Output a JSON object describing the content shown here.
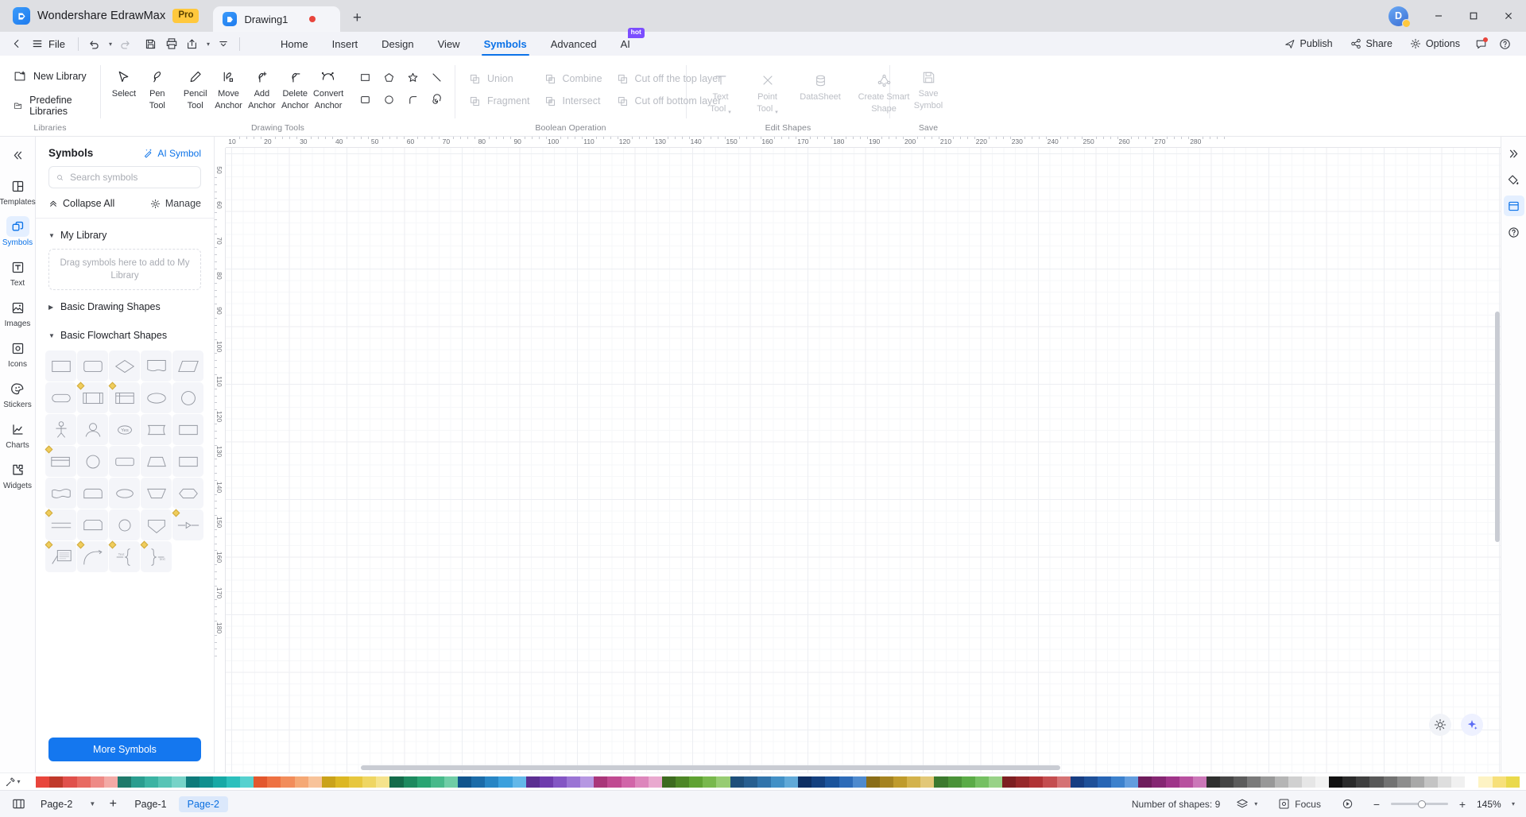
{
  "titlebar": {
    "app_name": "Wondershare EdrawMax",
    "pro_badge": "Pro",
    "document_tab": "Drawing1",
    "new_tab_label": "+",
    "avatar_initial": "D",
    "minimize": "─",
    "maximize": "□",
    "close": "✕"
  },
  "menubar": {
    "back_icon": "back-chevron-icon",
    "file_label": "File",
    "undo_icon": "undo-icon",
    "redo_icon": "redo-icon",
    "save_icon": "save-icon",
    "print_icon": "print-icon",
    "export_icon": "export-icon",
    "more_icon": "more-chevron-icon",
    "tabs": [
      {
        "label": "Home",
        "active": false
      },
      {
        "label": "Insert",
        "active": false
      },
      {
        "label": "Design",
        "active": false
      },
      {
        "label": "View",
        "active": false
      },
      {
        "label": "Symbols",
        "active": true
      },
      {
        "label": "Advanced",
        "active": false
      },
      {
        "label": "AI",
        "active": false,
        "badge": "hot"
      }
    ],
    "right_items": [
      {
        "label": "Publish",
        "icon": "publish-icon"
      },
      {
        "label": "Share",
        "icon": "share-icon"
      },
      {
        "label": "Options",
        "icon": "options-gear-icon"
      }
    ],
    "help_icon": "help-circle-icon",
    "chat_icon": "chat-bubble-icon"
  },
  "ribbon": {
    "groups": [
      {
        "title": "Libraries",
        "items": [
          {
            "label": "New Library",
            "icon": "new-library-icon"
          },
          {
            "label": "Predefine Libraries",
            "icon": "predefine-libraries-icon"
          }
        ]
      },
      {
        "title": "Drawing Tools",
        "tools": [
          {
            "label1": "Select",
            "label2": "",
            "icon": "cursor-arrow-icon"
          },
          {
            "label1": "Pen",
            "label2": "Tool",
            "icon": "pen-tool-icon"
          },
          {
            "label1": "Pencil",
            "label2": "Tool",
            "icon": "pencil-tool-icon"
          },
          {
            "label1": "Move",
            "label2": "Anchor",
            "icon": "move-anchor-icon"
          },
          {
            "label1": "Add",
            "label2": "Anchor",
            "icon": "add-anchor-icon"
          },
          {
            "label1": "Delete",
            "label2": "Anchor",
            "icon": "delete-anchor-icon"
          },
          {
            "label1": "Convert",
            "label2": "Anchor",
            "icon": "convert-anchor-icon"
          }
        ],
        "shapes": [
          "rectangle-icon",
          "pentagon-icon",
          "star-icon",
          "line-icon",
          "rounded-rectangle-icon",
          "circle-icon",
          "arc-icon",
          "spiral-icon"
        ]
      },
      {
        "title": "Boolean Operation",
        "items": [
          {
            "label": "Union",
            "icon": "union-icon"
          },
          {
            "label": "Combine",
            "icon": "combine-icon"
          },
          {
            "label": "Cut off the top layer",
            "icon": "cut-top-layer-icon"
          },
          {
            "label": "Fragment",
            "icon": "fragment-icon"
          },
          {
            "label": "Intersect",
            "icon": "intersect-icon"
          },
          {
            "label": "Cut off bottom layer",
            "icon": "cut-bottom-layer-icon"
          }
        ]
      },
      {
        "title": "Edit Shapes",
        "items": [
          {
            "label1": "Text",
            "label2": "Tool",
            "icon": "text-tool-icon",
            "caret": true
          },
          {
            "label1": "Point",
            "label2": "Tool",
            "icon": "point-tool-icon",
            "caret": true
          },
          {
            "label1": "DataSheet",
            "label2": "",
            "icon": "datasheet-icon",
            "caret": false
          },
          {
            "label1": "Create Smart",
            "label2": "Shape",
            "icon": "create-smart-shape-icon",
            "caret": false
          }
        ]
      },
      {
        "title": "Save",
        "items": [
          {
            "label1": "Save",
            "label2": "Symbol",
            "icon": "save-symbol-icon"
          }
        ]
      }
    ]
  },
  "left_rail": {
    "collapse_icon": "collapse-double-chevron-icon",
    "items": [
      {
        "label": "Templates",
        "icon": "templates-icon",
        "active": false
      },
      {
        "label": "Symbols",
        "icon": "symbols-icon",
        "active": true
      },
      {
        "label": "Text",
        "icon": "text-icon",
        "active": false
      },
      {
        "label": "Images",
        "icon": "images-icon",
        "active": false
      },
      {
        "label": "Icons",
        "icon": "icons-icon",
        "active": false
      },
      {
        "label": "Stickers",
        "icon": "stickers-icon",
        "active": false
      },
      {
        "label": "Charts",
        "icon": "charts-icon",
        "active": false
      },
      {
        "label": "Widgets",
        "icon": "widgets-icon",
        "active": false
      }
    ]
  },
  "panel": {
    "title": "Symbols",
    "ai_symbol_label": "AI Symbol",
    "ai_symbol_icon": "magic-wand-icon",
    "search_placeholder": "Search symbols",
    "search_value": "",
    "search_icon": "search-icon",
    "collapse_all_label": "Collapse All",
    "collapse_all_icon": "chevron-up-double-icon",
    "manage_label": "Manage",
    "manage_icon": "gear-icon",
    "sections": [
      {
        "label": "My Library",
        "expanded": true
      },
      {
        "label": "Basic Drawing Shapes",
        "expanded": false
      },
      {
        "label": "Basic Flowchart Shapes",
        "expanded": true
      }
    ],
    "dropzone_text": "Drag symbols here to add to My Library",
    "more_symbols_label": "More Symbols",
    "flowchart_shapes": [
      {
        "name": "process-rectangle",
        "badge": false
      },
      {
        "name": "rounded-rectangle",
        "badge": false
      },
      {
        "name": "decision-diamond",
        "badge": false
      },
      {
        "name": "document-wave",
        "badge": false
      },
      {
        "name": "parallelogram-data",
        "badge": false
      },
      {
        "name": "terminator-stadium",
        "badge": false
      },
      {
        "name": "predefined-process",
        "badge": true
      },
      {
        "name": "internal-storage",
        "badge": true
      },
      {
        "name": "ellipse-connector",
        "badge": false
      },
      {
        "name": "circle-connector",
        "badge": false
      },
      {
        "name": "actor-person",
        "badge": false
      },
      {
        "name": "user-head",
        "badge": false
      },
      {
        "name": "yes-label-oval",
        "badge": false
      },
      {
        "name": "stored-data",
        "badge": false
      },
      {
        "name": "card-rectangle",
        "badge": false
      },
      {
        "name": "multi-document-stack",
        "badge": true
      },
      {
        "name": "circle-plain",
        "badge": false
      },
      {
        "name": "tape-rounded",
        "badge": false
      },
      {
        "name": "trapezoid-manual",
        "badge": false
      },
      {
        "name": "offpage-rectangle",
        "badge": false
      },
      {
        "name": "wave-document",
        "badge": false
      },
      {
        "name": "rounded-tab",
        "badge": false
      },
      {
        "name": "oval-connector",
        "badge": false
      },
      {
        "name": "trapezoid-merge",
        "badge": false
      },
      {
        "name": "hexagon-flat",
        "badge": false
      },
      {
        "name": "parallel-lines",
        "badge": true
      },
      {
        "name": "octagon-cut",
        "badge": false
      },
      {
        "name": "circle-small",
        "badge": false
      },
      {
        "name": "pentagon-down",
        "badge": false
      },
      {
        "name": "arrow-connector",
        "badge": true
      },
      {
        "name": "callout-note",
        "badge": true
      },
      {
        "name": "curve-arc-arrow",
        "badge": true
      },
      {
        "name": "left-brace",
        "badge": true
      },
      {
        "name": "right-brace",
        "badge": true
      }
    ]
  },
  "right_rail": {
    "items": [
      {
        "icon": "collapse-right-icon",
        "active": false
      },
      {
        "icon": "fill-format-icon",
        "active": false
      },
      {
        "icon": "canvas-layout-icon",
        "active": true
      },
      {
        "icon": "help-question-icon",
        "active": false
      }
    ]
  },
  "canvas": {
    "ruler_h_labels": [
      10,
      20,
      30,
      40,
      50,
      60,
      70,
      80,
      90,
      100,
      110,
      120,
      130,
      140,
      150,
      160,
      170,
      180,
      190,
      200,
      210,
      220,
      230,
      240,
      250,
      260,
      270,
      280
    ],
    "ruler_v_labels": [
      50,
      60,
      70,
      80,
      90,
      100,
      110,
      120,
      130,
      140,
      150,
      160,
      170,
      180
    ],
    "fab_brightness_icon": "brightness-icon",
    "fab_ai_icon": "ai-sparkle-icon"
  },
  "statusbar": {
    "layout_icon": "page-layout-icon",
    "pages": [
      {
        "label": "Page-2",
        "active": false,
        "has_caret": true
      },
      {
        "label": "Page-1",
        "active": false,
        "has_caret": false
      },
      {
        "label": "Page-2",
        "active": true,
        "has_caret": false
      }
    ],
    "add_page_label": "+",
    "shape_count_label": "Number of shapes: 9",
    "layers_icon": "layers-icon",
    "focus_label": "Focus",
    "focus_icon": "focus-icon",
    "play_icon": "play-icon",
    "zoom_out": "−",
    "zoom_in": "+",
    "zoom_value": "145%",
    "zoom_caret": "chevron-down-icon"
  },
  "colorbar": {
    "picker_icon": "eyedropper-icon",
    "swatches": [
      "#ffffff",
      "#e8453c",
      "#c0392b",
      "#e0504b",
      "#e86a62",
      "#ee8a86",
      "#f3aaa6",
      "#1f7a6b",
      "#2a9d8f",
      "#3bb3a3",
      "#57c4b6",
      "#76d3c8",
      "#0e7a7a",
      "#10908f",
      "#17a9a6",
      "#2cc0bd",
      "#55d1cf",
      "#e3572e",
      "#ee7142",
      "#f28c5a",
      "#f5a875",
      "#f8c39a",
      "#caa21a",
      "#dcb723",
      "#e7c73e",
      "#efd663",
      "#f5e38c",
      "#146b4a",
      "#1d8a5f",
      "#2aa472",
      "#47b98a",
      "#6fcda6",
      "#10558d",
      "#1a6ba8",
      "#2785c4",
      "#3ba0dd",
      "#62b8e9",
      "#5b2f91",
      "#6e3bad",
      "#8355c4",
      "#9a74d4",
      "#b697e2",
      "#a9367a",
      "#c04a91",
      "#d165a8",
      "#dd86bc",
      "#e9a9cf",
      "#3d6b1f",
      "#4d8626",
      "#5fa232",
      "#78b84c",
      "#97cc72",
      "#1e4f7a",
      "#275f90",
      "#3174ab",
      "#4290c6",
      "#60a9d8",
      "#0d2f63",
      "#13407f",
      "#1b549c",
      "#2d6bb8",
      "#4e8ace",
      "#8a6d18",
      "#a58320",
      "#bf9b2c",
      "#d3b24b",
      "#e2c877",
      "#3c7a2e",
      "#4a9238",
      "#5aab46",
      "#75c062",
      "#98d287",
      "#7d1f21",
      "#96282a",
      "#b03335",
      "#c44d4f",
      "#d57274",
      "#173d82",
      "#1e5099",
      "#2765b5",
      "#3c81cd",
      "#629dde",
      "#6e1d5c",
      "#852672",
      "#9f3489",
      "#b8509f",
      "#cb77b8",
      "#2f2f2f",
      "#454545",
      "#5c5c5c",
      "#7a7a7a",
      "#989898",
      "#b5b5b5",
      "#d0d0d0",
      "#e6e6e6",
      "#f2f2f2",
      "#111111",
      "#2a2a2a",
      "#3f3f3f",
      "#585858",
      "#727272",
      "#8d8d8d",
      "#a8a8a8",
      "#c4c4c4",
      "#dedede",
      "#f0f0f0",
      "#ffffff",
      "#fdf3c4",
      "#f7e07a",
      "#ead94b"
    ]
  }
}
